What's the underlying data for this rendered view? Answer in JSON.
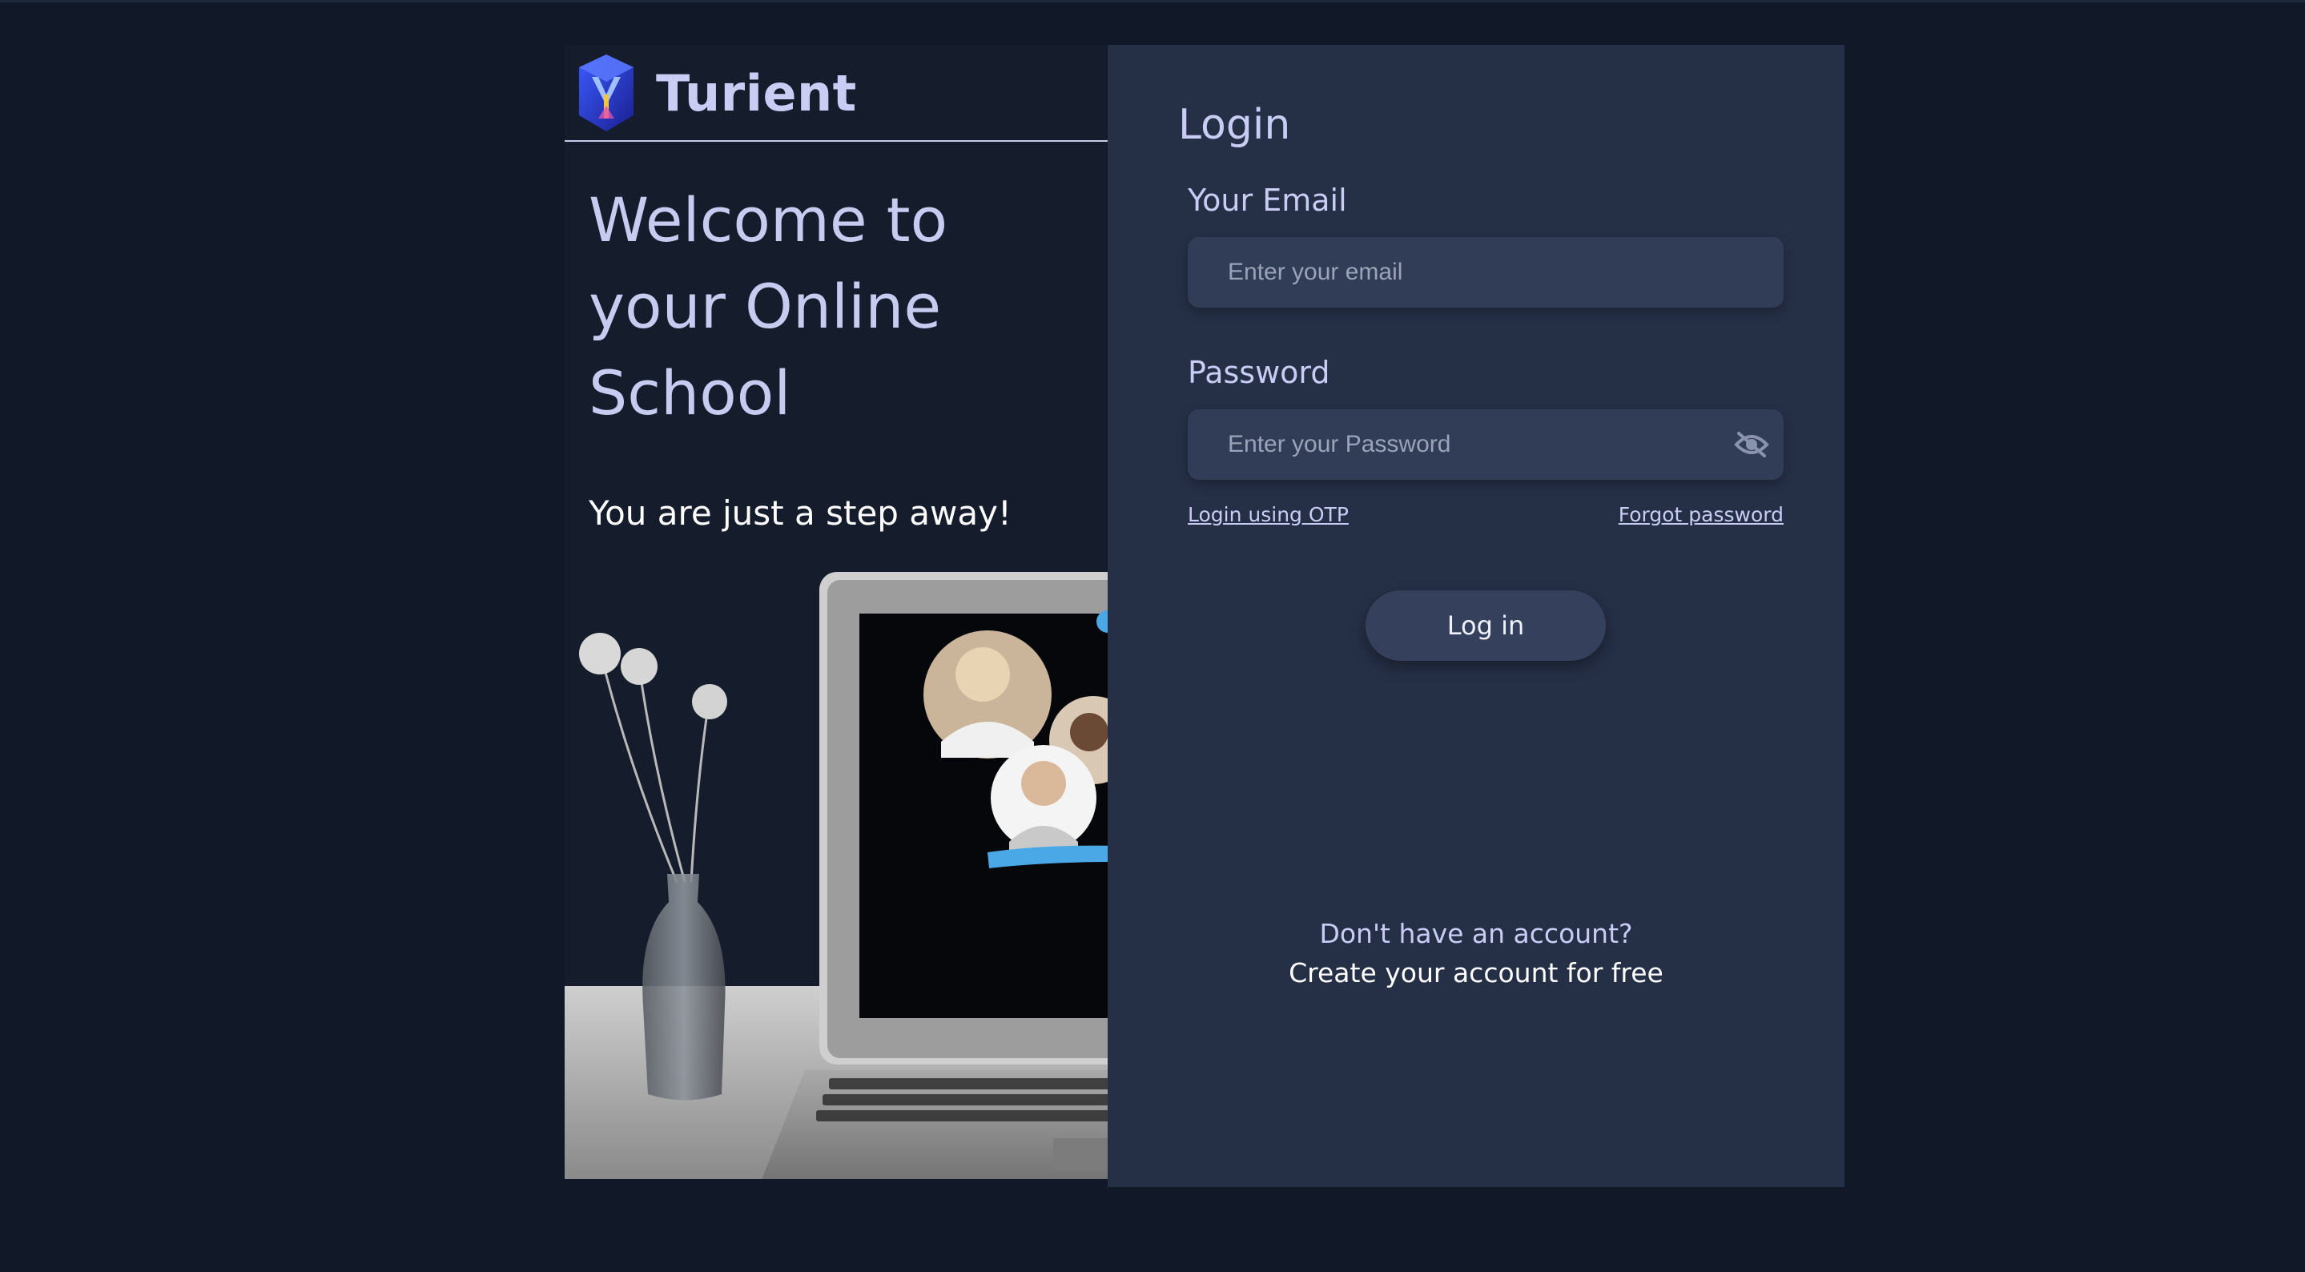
{
  "brand": {
    "name": "Turient",
    "logo_icon": "crystal-logo-icon"
  },
  "hero": {
    "heading_line1": "Welcome to",
    "heading_line2": "your Online",
    "heading_line3": "School",
    "tagline": "You are just a step away!"
  },
  "login": {
    "title": "Login",
    "email_label": "Your Email",
    "email_placeholder": "Enter your email",
    "email_value": "",
    "password_label": "Password",
    "password_placeholder": "Enter your Password",
    "password_value": "",
    "password_toggle_icon": "eye-off-icon",
    "otp_link": "Login using OTP",
    "forgot_link": "Forgot password",
    "submit_label": "Log in",
    "no_account_text": "Don't have an account?",
    "create_account_link": "Create your account for free"
  },
  "colors": {
    "page_bg": "#111827",
    "left_panel_bg": "#151c2c",
    "login_panel_bg": "#252f46",
    "input_bg": "#313d57",
    "button_bg": "#34405c",
    "heading_text": "#c6cbf0",
    "accent_blue": "#4aa8e6"
  }
}
